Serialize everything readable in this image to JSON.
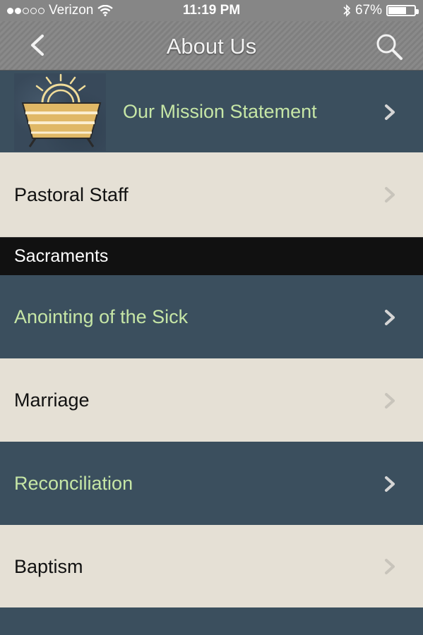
{
  "status_bar": {
    "carrier": "Verizon",
    "time": "11:19 PM",
    "battery": "67%",
    "signal_strength": 2,
    "battery_level": 0.67
  },
  "nav": {
    "title": "About Us",
    "back_icon": "chevron-left-icon",
    "search_icon": "search-icon"
  },
  "rows": [
    {
      "label": "Our Mission Statement"
    },
    {
      "label": "Pastoral Staff"
    }
  ],
  "section": {
    "title": "Sacraments"
  },
  "sacraments": [
    {
      "label": "Anointing of the Sick"
    },
    {
      "label": "Marriage"
    },
    {
      "label": "Reconciliation"
    },
    {
      "label": "Baptism"
    }
  ],
  "colors": {
    "dark_row": "#3b4f5e",
    "light_row": "#e5e0d5",
    "accent_text": "#c6e6a6",
    "section_header": "#111111"
  }
}
